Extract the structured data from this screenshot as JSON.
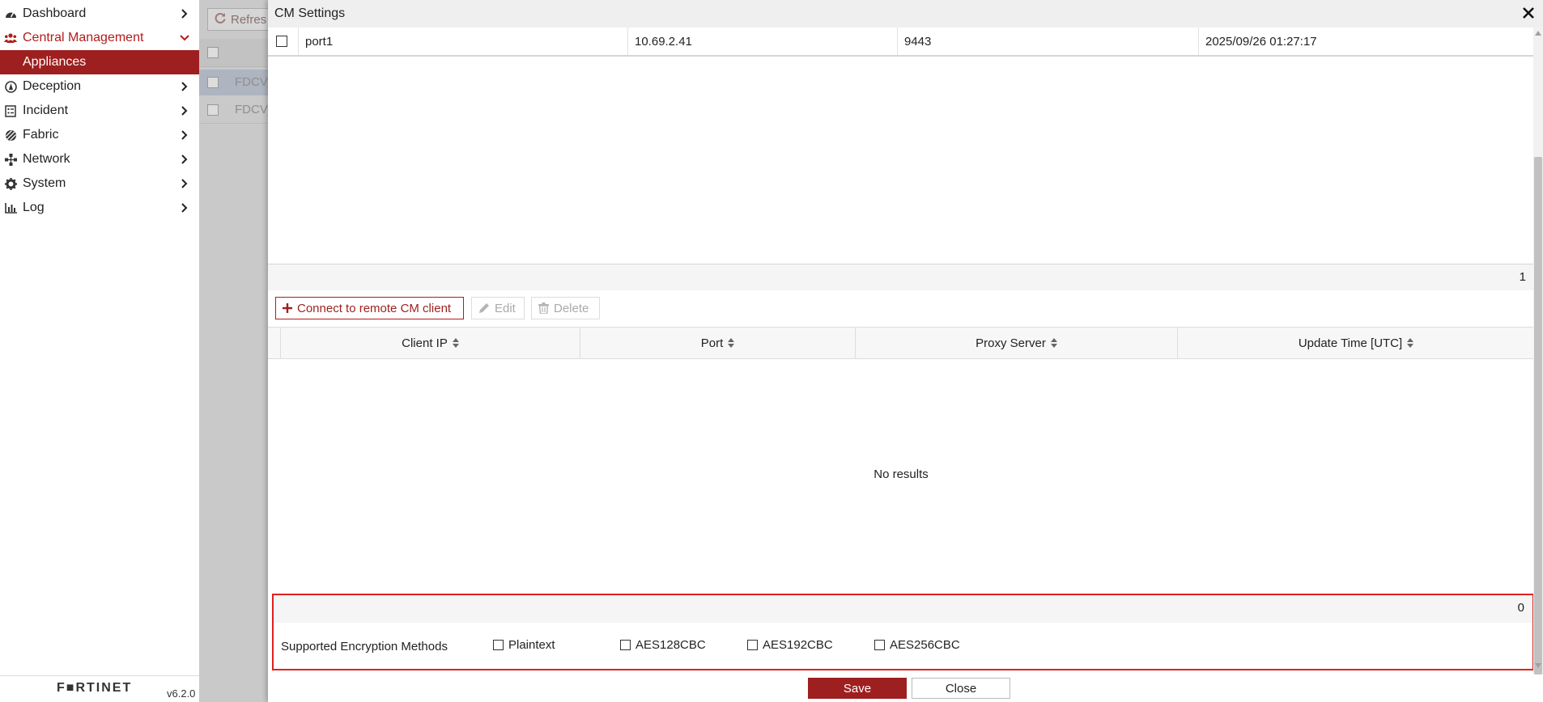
{
  "sidebar": {
    "items": [
      {
        "label": "Dashboard",
        "icon": "dashboard-icon"
      },
      {
        "label": "Central Management",
        "icon": "users-icon",
        "active": true
      },
      {
        "label": "Deception",
        "icon": "deception-icon"
      },
      {
        "label": "Incident",
        "icon": "incident-icon"
      },
      {
        "label": "Fabric",
        "icon": "fabric-icon"
      },
      {
        "label": "Network",
        "icon": "network-icon"
      },
      {
        "label": "System",
        "icon": "gear-icon"
      },
      {
        "label": "Log",
        "icon": "log-chart-icon"
      }
    ],
    "subitem": "Appliances",
    "brand": "F■RTINET",
    "version": "v6.2.0"
  },
  "background": {
    "refresh_label": "Refres",
    "rows": [
      "FDCV",
      "FDCV"
    ]
  },
  "modal": {
    "title": "CM Settings",
    "top_row": {
      "interface": "port1",
      "ip": "10.69.2.41",
      "port": "9443",
      "time": "2025/09/26 01:27:17"
    },
    "top_count": "1",
    "toolbar": {
      "connect_label": "Connect to remote CM client",
      "edit_label": "Edit",
      "delete_label": "Delete"
    },
    "columns": [
      "Client IP",
      "Port",
      "Proxy Server",
      "Update Time [UTC]"
    ],
    "empty_text": "No results",
    "bottom_count": "0",
    "encryption": {
      "label": "Supported Encryption Methods",
      "options": [
        "Plaintext",
        "AES128CBC",
        "AES192CBC",
        "AES256CBC"
      ]
    },
    "save_label": "Save",
    "close_label": "Close"
  },
  "colors": {
    "accent": "#9e1f1f",
    "highlight_border": "#e02020"
  }
}
